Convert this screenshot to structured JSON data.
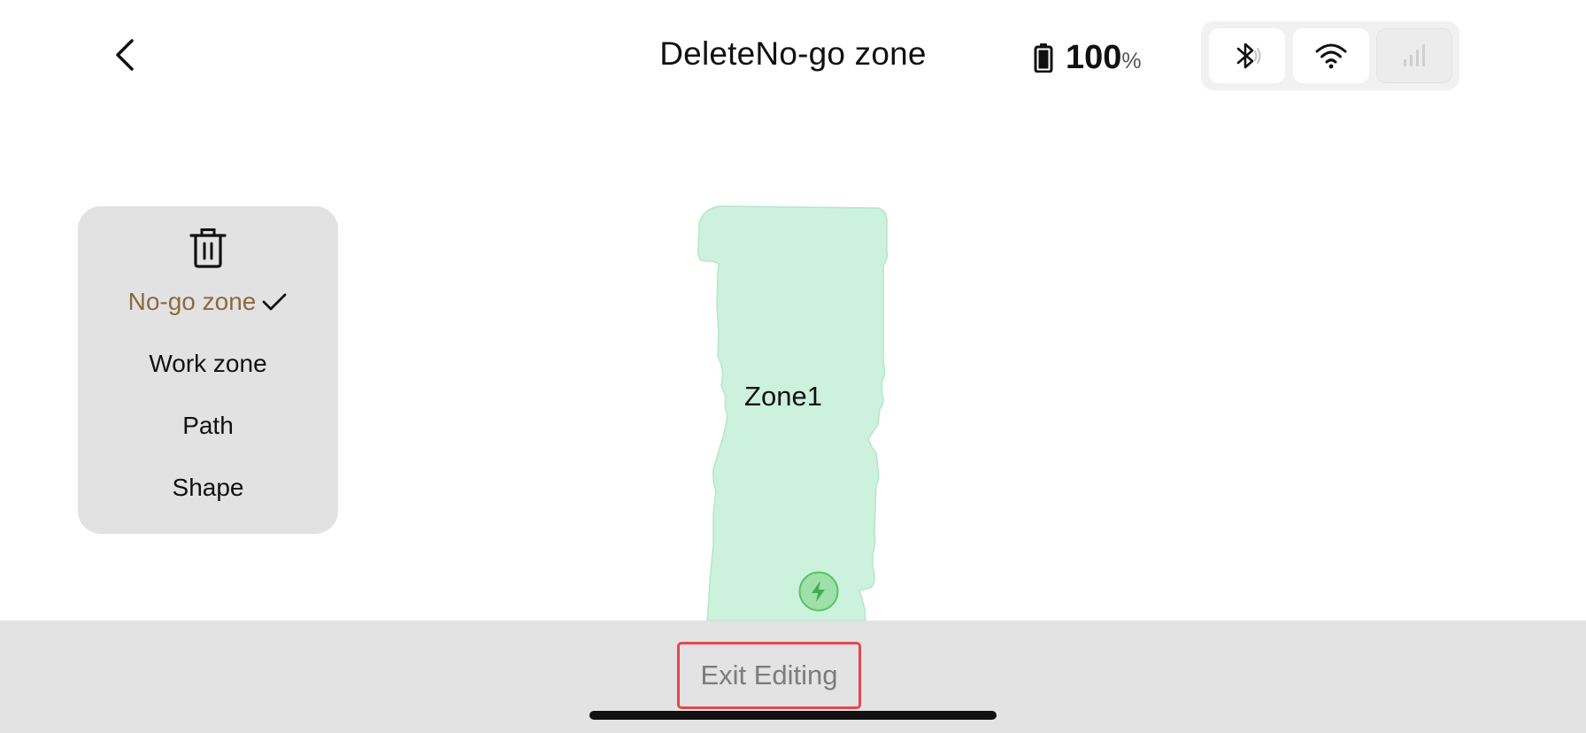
{
  "header": {
    "title": "DeleteNo-go zone",
    "battery": {
      "value": "100",
      "unit": "%"
    },
    "connectivity": {
      "bluetooth": "bluetooth-icon",
      "wifi": "wifi-icon",
      "cellular": "cellular-signal-icon"
    }
  },
  "side_menu": {
    "delete_icon": "trash-icon",
    "items": [
      {
        "label": "No-go zone",
        "selected": true
      },
      {
        "label": "Work zone",
        "selected": false
      },
      {
        "label": "Path",
        "selected": false
      },
      {
        "label": "Shape",
        "selected": false
      }
    ]
  },
  "map": {
    "zone_label": "Zone1",
    "zone_color": "#ccf2de",
    "charger_icon": "charging-station-icon"
  },
  "bottom_bar": {
    "exit_label": "Exit Editing",
    "highlight_color": "#e5484d"
  }
}
